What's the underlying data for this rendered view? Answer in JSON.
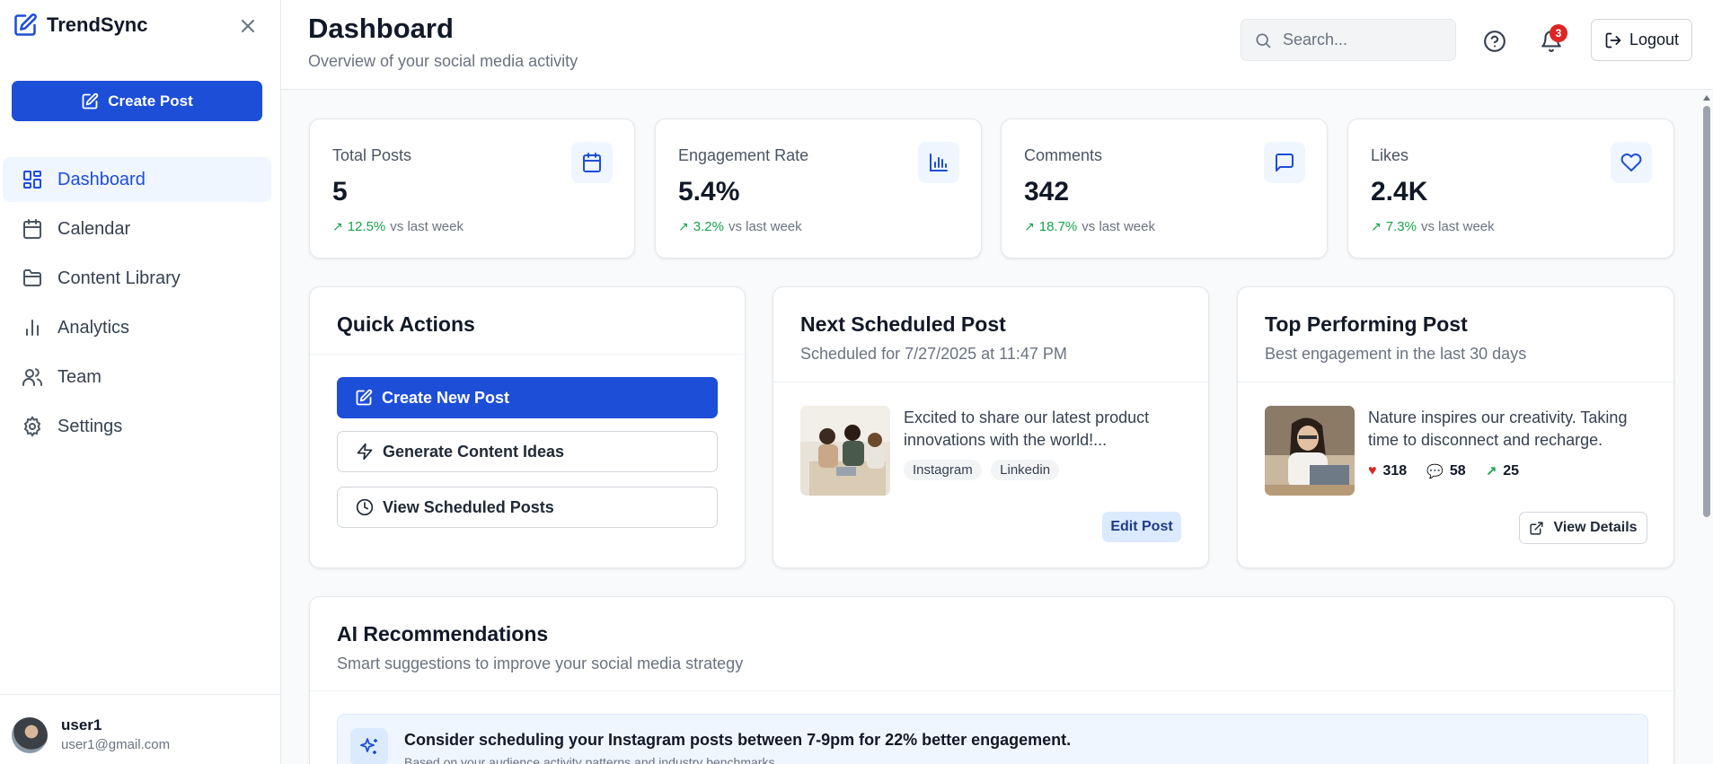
{
  "app": {
    "name": "TrendSync"
  },
  "sidebar": {
    "create_label": "Create Post",
    "items": [
      {
        "label": "Dashboard",
        "icon": "dashboard-icon",
        "active": true
      },
      {
        "label": "Calendar",
        "icon": "calendar-icon",
        "active": false
      },
      {
        "label": "Content Library",
        "icon": "folder-icon",
        "active": false
      },
      {
        "label": "Analytics",
        "icon": "bar-chart-icon",
        "active": false
      },
      {
        "label": "Team",
        "icon": "users-icon",
        "active": false
      },
      {
        "label": "Settings",
        "icon": "gear-icon",
        "active": false
      }
    ],
    "user": {
      "name": "user1",
      "email": "user1@gmail.com"
    }
  },
  "header": {
    "title": "Dashboard",
    "subtitle": "Overview of your social media activity",
    "search_placeholder": "Search...",
    "notification_count": "3",
    "logout_label": "Logout"
  },
  "stats": [
    {
      "label": "Total Posts",
      "value": "5",
      "change": "12.5%",
      "suffix": "vs last week",
      "icon": "calendar-icon"
    },
    {
      "label": "Engagement Rate",
      "value": "5.4%",
      "change": "3.2%",
      "suffix": "vs last week",
      "icon": "bar-chart-icon"
    },
    {
      "label": "Comments",
      "value": "342",
      "change": "18.7%",
      "suffix": "vs last week",
      "icon": "message-icon"
    },
    {
      "label": "Likes",
      "value": "2.4K",
      "change": "7.3%",
      "suffix": "vs last week",
      "icon": "heart-icon"
    }
  ],
  "quick_actions": {
    "title": "Quick Actions",
    "buttons": [
      "Create New Post",
      "Generate Content Ideas",
      "View Scheduled Posts"
    ]
  },
  "next_post": {
    "title": "Next Scheduled Post",
    "subtitle": "Scheduled for 7/27/2025 at 11:47 PM",
    "text": "Excited to share our latest product innovations with the world!...",
    "tags": [
      "Instagram",
      "Linkedin"
    ],
    "edit_label": "Edit Post"
  },
  "top_post": {
    "title": "Top Performing Post",
    "subtitle": "Best engagement in the last 30 days",
    "text": "Nature inspires our creativity. Taking time to disconnect and recharge.",
    "likes": "318",
    "comments": "58",
    "shares": "25",
    "view_label": "View Details"
  },
  "ai": {
    "title": "AI Recommendations",
    "subtitle": "Smart suggestions to improve your social media strategy",
    "rec_title": "Consider scheduling your Instagram posts between 7-9pm for 22% better engagement.",
    "rec_desc": "Based on your audience activity patterns and industry benchmarks"
  },
  "colors": {
    "accent": "#1d4ed8",
    "positive": "#16a34a",
    "badge": "#dc2626"
  }
}
